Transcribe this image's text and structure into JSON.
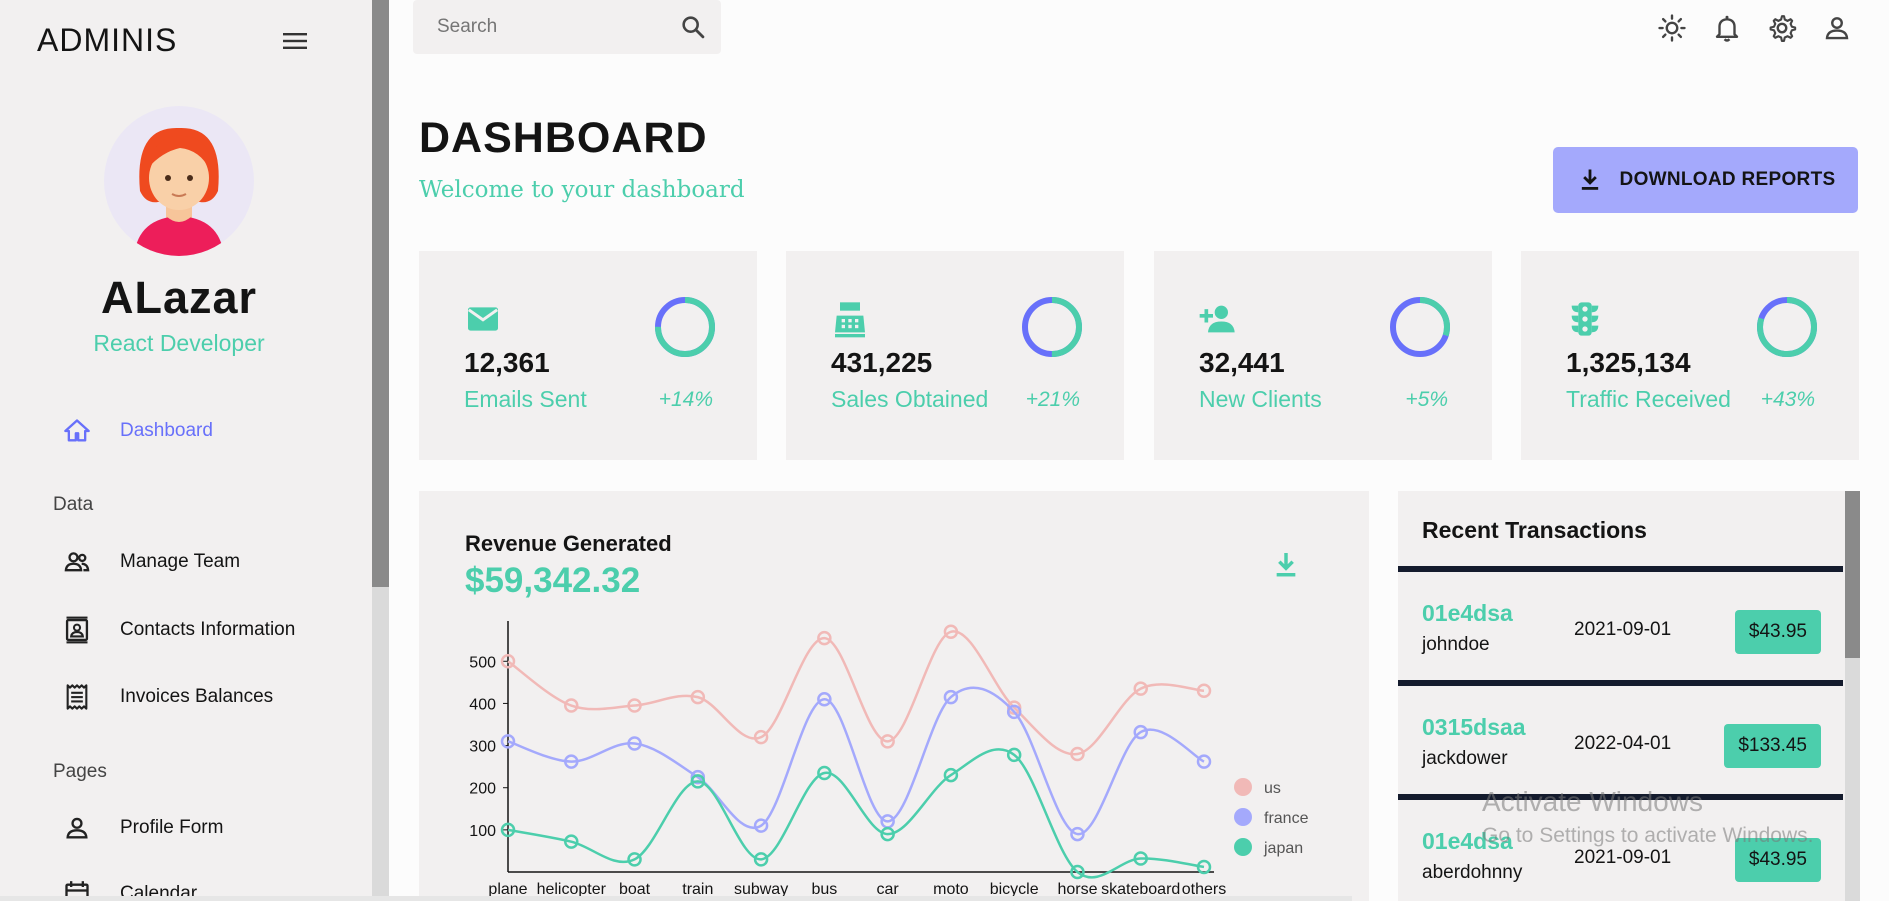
{
  "app": {
    "brand": "ADMINIS"
  },
  "profile": {
    "name": "ALazar",
    "role": "React Developer"
  },
  "nav": {
    "dashboard": "Dashboard",
    "section_data": "Data",
    "manage_team": "Manage Team",
    "contacts": "Contacts Information",
    "invoices": "Invoices Balances",
    "section_pages": "Pages",
    "profile_form": "Profile Form",
    "calendar": "Calendar"
  },
  "search": {
    "placeholder": "Search"
  },
  "header": {
    "title": "DASHBOARD",
    "subtitle": "Welcome to your dashboard",
    "download_label": "DOWNLOAD REPORTS"
  },
  "stats": [
    {
      "value": "12,361",
      "label": "Emails Sent",
      "delta": "+14%",
      "icon": "email-icon",
      "progress": 0.75
    },
    {
      "value": "431,225",
      "label": "Sales Obtained",
      "delta": "+21%",
      "icon": "point-of-sale-icon",
      "progress": 0.5
    },
    {
      "value": "32,441",
      "label": "New Clients",
      "delta": "+5%",
      "icon": "person-add-icon",
      "progress": 0.3
    },
    {
      "value": "1,325,134",
      "label": "Traffic Received",
      "delta": "+43%",
      "icon": "traffic-icon",
      "progress": 0.8
    }
  ],
  "revenue": {
    "title": "Revenue Generated",
    "value": "$59,342.32"
  },
  "transactions": {
    "title": "Recent Transactions",
    "rows": [
      {
        "txId": "01e4dsa",
        "user": "johndoe",
        "date": "2021-09-01",
        "cost": "$43.95"
      },
      {
        "txId": "0315dsaa",
        "user": "jackdower",
        "date": "2022-04-01",
        "cost": "$133.45"
      },
      {
        "txId": "01e4dsa",
        "user": "aberdohnny",
        "date": "2021-09-01",
        "cost": "$43.95"
      }
    ]
  },
  "watermark": {
    "line1": "Activate Windows",
    "line2": "Go to Settings to activate Windows."
  },
  "colors": {
    "accent": "#4cceac",
    "primary": "#6870fa",
    "button": "#a4a9fc",
    "us": "#f1b9b7",
    "france": "#a4a9fc",
    "japan": "#4cceac"
  },
  "chart_data": {
    "type": "line",
    "categories": [
      "plane",
      "helicopter",
      "boat",
      "train",
      "subway",
      "bus",
      "car",
      "moto",
      "bicycle",
      "horse",
      "skateboard",
      "others"
    ],
    "ylim": [
      0,
      560
    ],
    "yticks": [
      100,
      200,
      300,
      400,
      500
    ],
    "legend_position": "right",
    "series": [
      {
        "name": "us",
        "color": "#f1b9b7",
        "values": [
          500,
          395,
          395,
          415,
          320,
          555,
          310,
          570,
          390,
          280,
          435,
          430
        ]
      },
      {
        "name": "france",
        "color": "#a4a9fc",
        "values": [
          310,
          262,
          305,
          225,
          110,
          410,
          120,
          415,
          380,
          90,
          332,
          262
        ]
      },
      {
        "name": "japan",
        "color": "#4cceac",
        "values": [
          100,
          72,
          30,
          215,
          30,
          235,
          90,
          230,
          278,
          0,
          32,
          12
        ]
      }
    ]
  }
}
